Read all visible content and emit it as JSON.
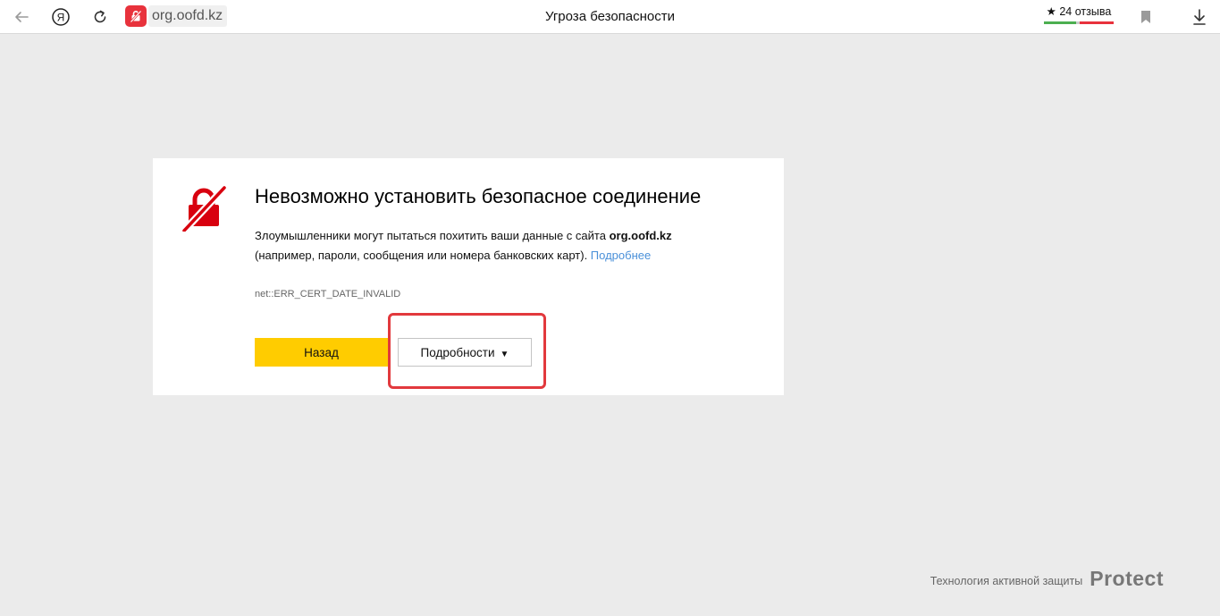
{
  "toolbar": {
    "back_icon": "arrow-left-icon",
    "yandex_icon": "yandex-logo-icon",
    "reload_icon": "reload-icon",
    "address_warning_icon": "broken-lock-icon",
    "host": "org.oofd.kz",
    "page_title": "Угроза безопасности",
    "reviews_label": "★ 24 отзыва",
    "reviews_colors": {
      "positive": "#4caf50",
      "neutral": "#cccccc",
      "negative": "#e8323c"
    },
    "bookmark_icon": "bookmark-icon",
    "download_icon": "download-icon"
  },
  "error": {
    "icon": "broken-lock-icon",
    "title": "Невозможно установить безопасное соединение",
    "desc_before": "Злоумышленники могут пытаться похитить ваши данные с сайта ",
    "desc_host": "org.oofd.kz",
    "desc_after": " (например, пароли, сообщения или номера банковских карт). ",
    "more_link": "Подробнее",
    "code": "net::ERR_CERT_DATE_INVALID",
    "back_button": "Назад",
    "details_button": "Подробности",
    "details_arrow": "▼"
  },
  "footer": {
    "tech_label": "Технология активной защиты",
    "protect_logo": "Protect"
  },
  "colors": {
    "accent_yellow": "#ffcc00",
    "danger_red": "#e8323c",
    "link_blue": "#4a90d9",
    "highlight_red": "#e2393d",
    "page_bg": "#ebebeb"
  }
}
